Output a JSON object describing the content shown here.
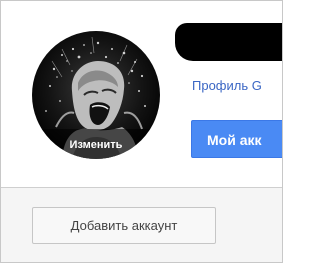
{
  "account": {
    "avatar_change_label": "Изменить",
    "profile_link": "Профиль G",
    "my_account_button": "Мой акк"
  },
  "footer": {
    "add_account_button": "Добавить аккаунт"
  },
  "icons": {
    "avatar": "avatar-photo"
  },
  "colors": {
    "primary_button": "#4a8af4",
    "link": "#3a66c4",
    "footer_bg": "#f5f5f5"
  }
}
